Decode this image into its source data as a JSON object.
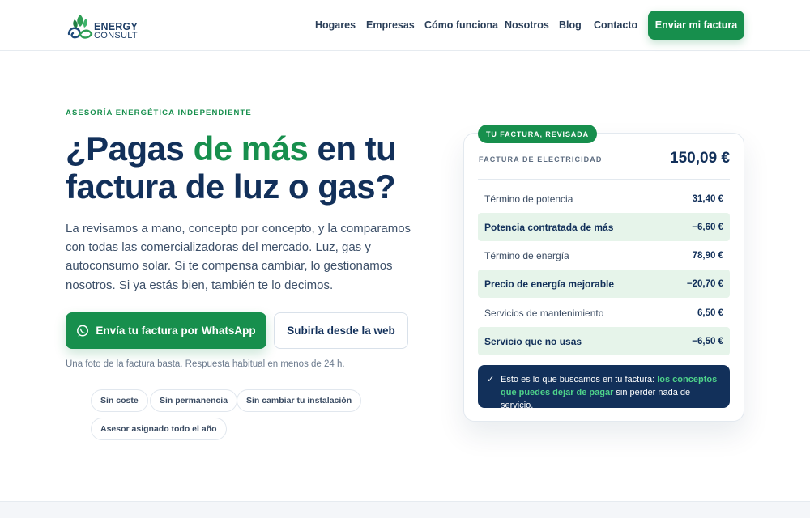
{
  "brand": {
    "line1": "ENERGY",
    "line2": "CONSULT"
  },
  "nav": {
    "items": [
      "Hogares",
      "Empresas",
      "Cómo funciona",
      "Nosotros",
      "Blog",
      "Contacto"
    ],
    "cta": "Enviar mi factura"
  },
  "hero": {
    "eyebrow": "ASESORÍA ENERGÉTICA INDEPENDIENTE",
    "title_before": "¿Pagas ",
    "title_highlight": "de más",
    "title_after": " en tu factura de luz o gas?",
    "lead": "La revisamos a mano, concepto por concepto, y la comparamos con todas las comercializadoras del mercado. Luz, gas y autoconsumo solar. Si te compensa cambiar, lo gestionamos nosotros. Si ya estás bien, también te lo decimos.",
    "cta_primary": "Envía tu factura por WhatsApp",
    "cta_secondary": "Subirla desde la web",
    "note": "Una foto de la factura basta. Respuesta habitual en menos de 24 h.",
    "pills": [
      "Sin coste",
      "Sin permanencia",
      "Sin cambiar tu instalación",
      "Asesor asignado todo el año"
    ]
  },
  "invoice": {
    "badge": "TU FACTURA, REVISADA",
    "label": "FACTURA DE ELECTRICIDAD",
    "total": "150,09 €",
    "rows": [
      {
        "label": "Término de potencia",
        "value": "31,40 €"
      },
      {
        "label": "Potencia contratada de más",
        "value": "−6,60 €"
      },
      {
        "label": "Término de energía",
        "value": "78,90 €"
      },
      {
        "label": "Precio de energía mejorable",
        "value": "−20,70 €"
      },
      {
        "label": "Servicios de mantenimiento",
        "value": "6,50 €"
      },
      {
        "label": "Servicio que no usas",
        "value": "−6,50 €"
      }
    ],
    "info_check": "✓",
    "info_before": "Esto es lo que buscamos en tu factura: ",
    "info_highlight": "los conceptos que puedes dejar de pagar",
    "info_after": " sin perder nada de servicio."
  },
  "colors": {
    "brand_green": "#178f4d",
    "navy": "#12305a",
    "highlight_bg": "#e6f4ea"
  },
  "icons": {
    "logo": "leaf-logo-icon",
    "whatsapp": "whatsapp-icon"
  }
}
